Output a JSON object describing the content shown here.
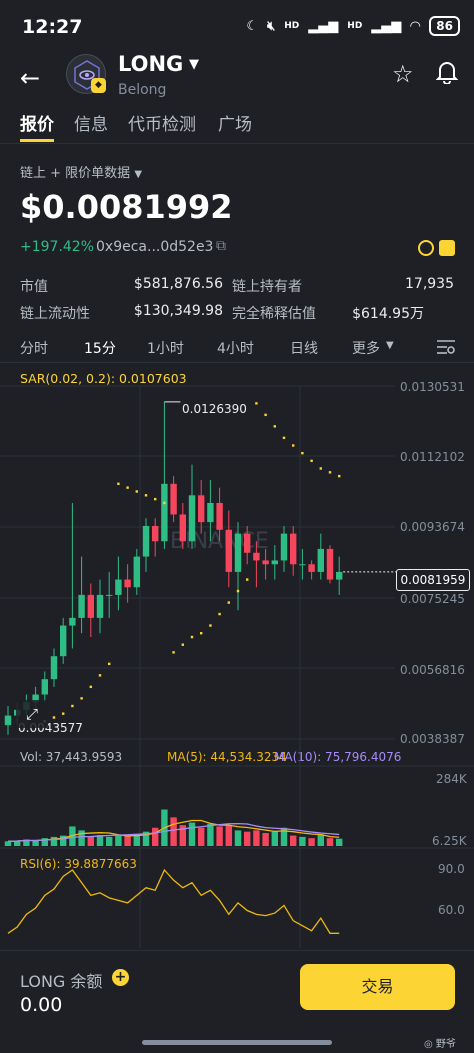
{
  "status": {
    "time": "12:27",
    "hd1": "HD",
    "hd2": "HD",
    "battery": "86"
  },
  "header": {
    "title": "LONG",
    "subtitle": "Belong"
  },
  "tabs": [
    {
      "label": "报价"
    },
    {
      "label": "信息"
    },
    {
      "label": "代币检测"
    },
    {
      "label": "广场"
    }
  ],
  "data_source": "链上 + 限价单数据",
  "price": "$0.0081992",
  "change": "+197.42%",
  "address": "0x9eca...0d52e3",
  "stats": [
    {
      "label": "市值",
      "value": "$581,876.56"
    },
    {
      "label": "链上持有者",
      "value": "17,935"
    },
    {
      "label": "链上流动性",
      "value": "$130,349.98"
    },
    {
      "label": "完全稀释估值",
      "value": "$614.95万"
    }
  ],
  "timeframes": [
    {
      "label": "分时"
    },
    {
      "label": "15分"
    },
    {
      "label": "1小时"
    },
    {
      "label": "4小时"
    },
    {
      "label": "日线"
    },
    {
      "label": "更多"
    }
  ],
  "indicators": {
    "sar": "SAR(0.02, 0.2): 0.0107603",
    "vol": "Vol: 37,443.9593",
    "ma5": "MA(5): 44,534.3234",
    "ma10": "MA(10): 75,796.4076",
    "rsi": "RSI(6): 39.8877663"
  },
  "price_axis": [
    "0.0130531",
    "0.0112102",
    "0.0093674",
    "0.0075245",
    "0.0056816",
    "0.0038387"
  ],
  "price_marks": {
    "high": "0.0126390",
    "low": "0.0043577",
    "current": "0.0081959"
  },
  "volume_axis": [
    "284K",
    "6.25K"
  ],
  "rsi_axis": [
    "90.0",
    "60.0"
  ],
  "watermark": "BINANCE",
  "balance": {
    "label": "LONG 余额",
    "value": "0.00"
  },
  "trade_button": "交易",
  "footer_credit": "野爷",
  "colors": {
    "up": "#2ebd85",
    "down": "#f6465d",
    "accent": "#fcd535",
    "sar": "#fcd535",
    "ma5": "#f0b90b",
    "ma10": "#a78bfa"
  },
  "chart_data": {
    "type": "candlestick",
    "candles": [
      {
        "o": 0.0042,
        "h": 0.0047,
        "l": 0.00395,
        "c": 0.00445
      },
      {
        "o": 0.00445,
        "h": 0.0048,
        "l": 0.0042,
        "c": 0.0046
      },
      {
        "o": 0.0046,
        "h": 0.005,
        "l": 0.0044,
        "c": 0.0048
      },
      {
        "o": 0.0048,
        "h": 0.0052,
        "l": 0.0046,
        "c": 0.005
      },
      {
        "o": 0.005,
        "h": 0.0056,
        "l": 0.0048,
        "c": 0.0054
      },
      {
        "o": 0.0054,
        "h": 0.0062,
        "l": 0.0052,
        "c": 0.006
      },
      {
        "o": 0.006,
        "h": 0.007,
        "l": 0.0058,
        "c": 0.0068
      },
      {
        "o": 0.0068,
        "h": 0.01,
        "l": 0.0062,
        "c": 0.007
      },
      {
        "o": 0.007,
        "h": 0.0086,
        "l": 0.0066,
        "c": 0.0076
      },
      {
        "o": 0.0076,
        "h": 0.0079,
        "l": 0.0065,
        "c": 0.007
      },
      {
        "o": 0.007,
        "h": 0.008,
        "l": 0.0066,
        "c": 0.0076
      },
      {
        "o": 0.0076,
        "h": 0.0082,
        "l": 0.007,
        "c": 0.0076
      },
      {
        "o": 0.0076,
        "h": 0.0086,
        "l": 0.0072,
        "c": 0.008
      },
      {
        "o": 0.008,
        "h": 0.0084,
        "l": 0.0074,
        "c": 0.0078
      },
      {
        "o": 0.0078,
        "h": 0.0088,
        "l": 0.0076,
        "c": 0.0086
      },
      {
        "o": 0.0086,
        "h": 0.0096,
        "l": 0.0082,
        "c": 0.0094
      },
      {
        "o": 0.0094,
        "h": 0.0096,
        "l": 0.0086,
        "c": 0.009
      },
      {
        "o": 0.009,
        "h": 0.01264,
        "l": 0.0088,
        "c": 0.0105
      },
      {
        "o": 0.0105,
        "h": 0.0107,
        "l": 0.0095,
        "c": 0.0097
      },
      {
        "o": 0.0097,
        "h": 0.01,
        "l": 0.0088,
        "c": 0.009
      },
      {
        "o": 0.009,
        "h": 0.011,
        "l": 0.0088,
        "c": 0.0102
      },
      {
        "o": 0.0102,
        "h": 0.0106,
        "l": 0.0092,
        "c": 0.0095
      },
      {
        "o": 0.0095,
        "h": 0.0106,
        "l": 0.009,
        "c": 0.01
      },
      {
        "o": 0.01,
        "h": 0.0104,
        "l": 0.009,
        "c": 0.0093
      },
      {
        "o": 0.0093,
        "h": 0.0098,
        "l": 0.0078,
        "c": 0.0082
      },
      {
        "o": 0.0082,
        "h": 0.0095,
        "l": 0.0072,
        "c": 0.0092
      },
      {
        "o": 0.0092,
        "h": 0.0094,
        "l": 0.0084,
        "c": 0.0087
      },
      {
        "o": 0.0087,
        "h": 0.009,
        "l": 0.0078,
        "c": 0.0085
      },
      {
        "o": 0.0085,
        "h": 0.0088,
        "l": 0.008,
        "c": 0.0084
      },
      {
        "o": 0.0084,
        "h": 0.0089,
        "l": 0.008,
        "c": 0.0085
      },
      {
        "o": 0.0085,
        "h": 0.0094,
        "l": 0.0082,
        "c": 0.0092
      },
      {
        "o": 0.0092,
        "h": 0.0094,
        "l": 0.0081,
        "c": 0.0084
      },
      {
        "o": 0.0084,
        "h": 0.0088,
        "l": 0.008,
        "c": 0.0084
      },
      {
        "o": 0.0084,
        "h": 0.0085,
        "l": 0.008,
        "c": 0.0082
      },
      {
        "o": 0.0082,
        "h": 0.0092,
        "l": 0.008,
        "c": 0.0088
      },
      {
        "o": 0.0088,
        "h": 0.0089,
        "l": 0.0079,
        "c": 0.008
      },
      {
        "o": 0.008,
        "h": 0.0086,
        "l": 0.0076,
        "c": 0.0082
      }
    ],
    "sar": [
      0.0043,
      0.0044,
      0.0045,
      0.0047,
      0.0049,
      0.0052,
      0.0055,
      0.0058,
      0.0105,
      0.0104,
      0.0103,
      0.0102,
      0.0101,
      0.01,
      0.0061,
      0.0063,
      0.0065,
      0.0066,
      0.0068,
      0.0071,
      0.0074,
      0.0077,
      0.008,
      0.0126,
      0.0123,
      0.012,
      0.0117,
      0.0115,
      0.0113,
      0.0111,
      0.0109,
      0.0108,
      0.0107
    ],
    "volume": [
      18,
      20,
      25,
      22,
      30,
      35,
      40,
      75,
      60,
      38,
      42,
      35,
      40,
      38,
      45,
      55,
      70,
      140,
      110,
      80,
      90,
      70,
      85,
      75,
      80,
      60,
      55,
      60,
      50,
      55,
      70,
      40,
      35,
      30,
      45,
      30,
      28
    ],
    "rsi": [
      40,
      45,
      55,
      60,
      70,
      75,
      85,
      90,
      80,
      70,
      72,
      68,
      66,
      64,
      70,
      76,
      74,
      90,
      82,
      76,
      80,
      70,
      74,
      66,
      55,
      64,
      58,
      55,
      54,
      56,
      62,
      50,
      46,
      42,
      52,
      40,
      40
    ],
    "ylim": [
      0.0038387,
      0.0130531
    ],
    "vol_max": 284
  }
}
